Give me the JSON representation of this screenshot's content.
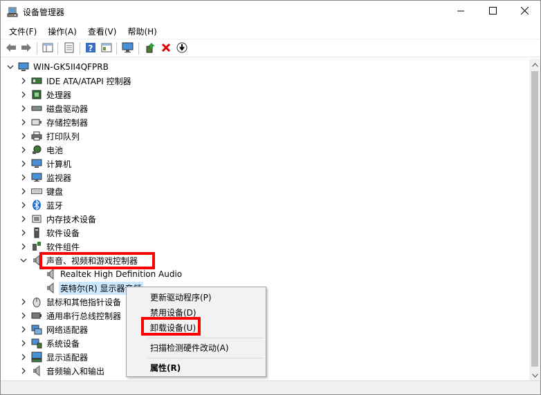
{
  "window": {
    "title": "设备管理器"
  },
  "menubar": {
    "items": [
      "文件(F)",
      "操作(A)",
      "查看(V)",
      "帮助(H)"
    ]
  },
  "toolbar": {
    "icons": [
      "back-arrow-icon",
      "forward-arrow-icon",
      "show-hide-tree-icon",
      "properties-icon",
      "help-icon",
      "view-icon",
      "monitor-icon",
      "update-driver-icon",
      "uninstall-x-icon",
      "download-icon"
    ]
  },
  "tree": {
    "root": "WIN-GK5II4QFPRB",
    "items": [
      {
        "label": "IDE ATA/ATAPI 控制器",
        "icon": "ide-icon"
      },
      {
        "label": "处理器",
        "icon": "processor-icon"
      },
      {
        "label": "磁盘驱动器",
        "icon": "disk-icon"
      },
      {
        "label": "存储控制器",
        "icon": "storage-icon"
      },
      {
        "label": "打印队列",
        "icon": "printer-icon"
      },
      {
        "label": "电池",
        "icon": "battery-icon"
      },
      {
        "label": "计算机",
        "icon": "computer-icon"
      },
      {
        "label": "监视器",
        "icon": "monitor-icon"
      },
      {
        "label": "键盘",
        "icon": "keyboard-icon"
      },
      {
        "label": "蓝牙",
        "icon": "bluetooth-icon"
      },
      {
        "label": "内存技术设备",
        "icon": "memory-icon"
      },
      {
        "label": "软件设备",
        "icon": "software-device-icon"
      },
      {
        "label": "软件组件",
        "icon": "software-component-icon"
      },
      {
        "label": "声音、视频和游戏控制器",
        "icon": "speaker-icon"
      },
      {
        "label": "Realtek High Definition Audio",
        "icon": "speaker-icon"
      },
      {
        "label": "英特尔(R) 显示器音频",
        "icon": "speaker-icon"
      },
      {
        "label": "鼠标和其他指针设备",
        "icon": "mouse-icon"
      },
      {
        "label": "通用串行总线控制器",
        "icon": "usb-icon"
      },
      {
        "label": "网络适配器",
        "icon": "network-icon"
      },
      {
        "label": "系统设备",
        "icon": "system-icon"
      },
      {
        "label": "显示适配器",
        "icon": "display-adapter-icon"
      },
      {
        "label": "音频输入和输出",
        "icon": "audio-io-icon"
      }
    ]
  },
  "context_menu": {
    "items": [
      {
        "label": "更新驱动程序(P)"
      },
      {
        "label": "禁用设备(D)"
      },
      {
        "label": "卸载设备(U)"
      },
      {
        "label": "扫描检测硬件改动(A)"
      },
      {
        "label": "属性(R)"
      }
    ]
  },
  "colors": {
    "highlight": "#ff0000",
    "selection": "#cce8ff"
  }
}
